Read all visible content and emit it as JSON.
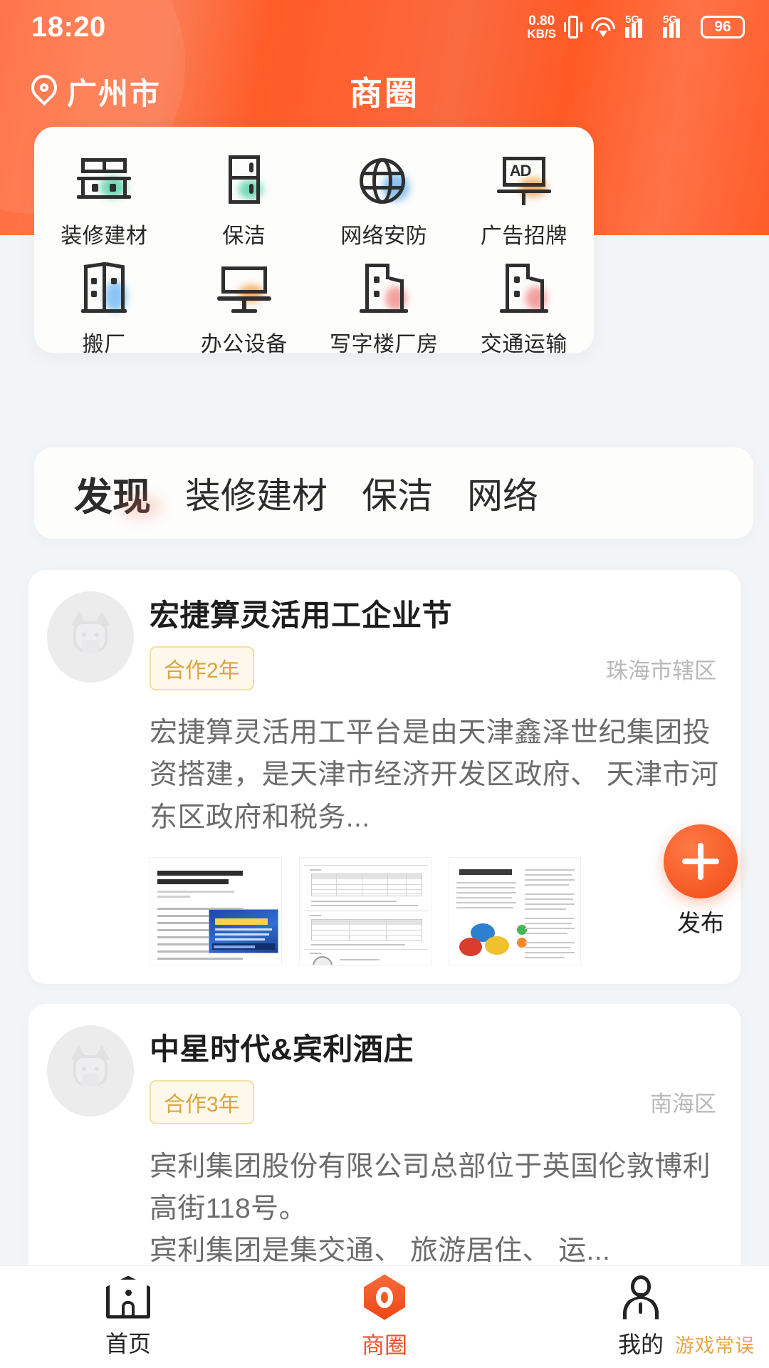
{
  "status_bar": {
    "time": "18:20",
    "net_speed_value": "0.80",
    "net_speed_unit": "KB/S",
    "vibrate_icon": "vibrate-icon",
    "wifi_icon": "wifi-icon",
    "signal_label_1": "5G",
    "signal_label_2": "5G",
    "battery_level": "96"
  },
  "header": {
    "location_icon": "location-pin-icon",
    "location": "广州市",
    "title": "商圈",
    "accent_color": "#ff5c28"
  },
  "categories": [
    {
      "label": "装修建材",
      "icon": "building-material-icon"
    },
    {
      "label": "保洁",
      "icon": "refrigerator-cleaning-icon"
    },
    {
      "label": "网络安防",
      "icon": "globe-network-icon"
    },
    {
      "label": "广告招牌",
      "icon": "ad-billboard-icon"
    },
    {
      "label": "搬厂",
      "icon": "factory-move-icon"
    },
    {
      "label": "办公设备",
      "icon": "monitor-office-icon"
    },
    {
      "label": "写字楼厂房",
      "icon": "office-building-icon"
    },
    {
      "label": "交通运输",
      "icon": "transport-building-icon"
    }
  ],
  "tabs": [
    {
      "label": "发现",
      "active": true
    },
    {
      "label": "装修建材",
      "active": false
    },
    {
      "label": "保洁",
      "active": false
    },
    {
      "label": "网络",
      "active": false
    }
  ],
  "feed": [
    {
      "avatar_icon": "cat-avatar-placeholder",
      "title": "宏捷算灵活用工企业节",
      "badge": "合作2年",
      "location": "珠海市辖区",
      "body": "宏捷算灵活用工平台是由天津鑫泽世纪集团投资搭建，是天津市经济开发区政府、 天津市河东区政府和税务...",
      "thumbnails": [
        {
          "name": "news-article-thumbnail",
          "caption": "《关于深化“上云用数赋智”行动 培育数字经济新业态的意见》"
        },
        {
          "name": "table-document-thumbnail",
          "caption": ""
        },
        {
          "name": "infographic-thumbnail",
          "caption": "什么是灵活用工"
        }
      ]
    },
    {
      "avatar_icon": "cat-avatar-placeholder",
      "title": "中星时代&宾利酒庄",
      "badge": "合作3年",
      "location": "南海区",
      "body": "宾利集团股份有限公司总部位于英国伦敦博利高街118号。\n宾利集团是集交通、 旅游居住、 运...",
      "thumbnails": []
    }
  ],
  "fab": {
    "icon": "plus-icon",
    "label": "发布",
    "color": "#f4541f"
  },
  "bottom_nav": [
    {
      "label": "首页",
      "icon": "home-icon",
      "active": false
    },
    {
      "label": "商圈",
      "icon": "business-circle-icon",
      "active": true
    },
    {
      "label": "我的",
      "icon": "person-icon",
      "active": false
    }
  ],
  "watermark": "游戏常误"
}
